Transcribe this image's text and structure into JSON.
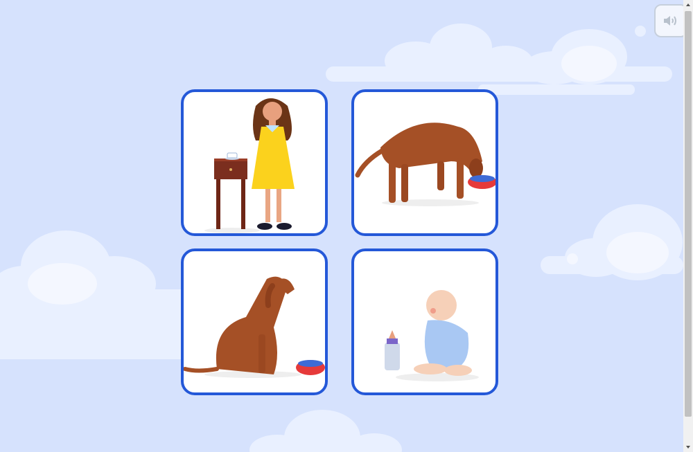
{
  "colors": {
    "background": "#d6e2fd",
    "card_border": "#2458d8",
    "card_fill": "#ffffff",
    "cloud": "#eef3ff"
  },
  "audio_button": {
    "icon": "speaker-icon"
  },
  "cards": [
    {
      "id": "card-1",
      "picture": "girl-yellow-dress-bedside-table"
    },
    {
      "id": "card-2",
      "picture": "dog-eating-from-bowl"
    },
    {
      "id": "card-3",
      "picture": "dog-sitting-by-bowl"
    },
    {
      "id": "card-4",
      "picture": "baby-sitting-with-bottle"
    }
  ]
}
